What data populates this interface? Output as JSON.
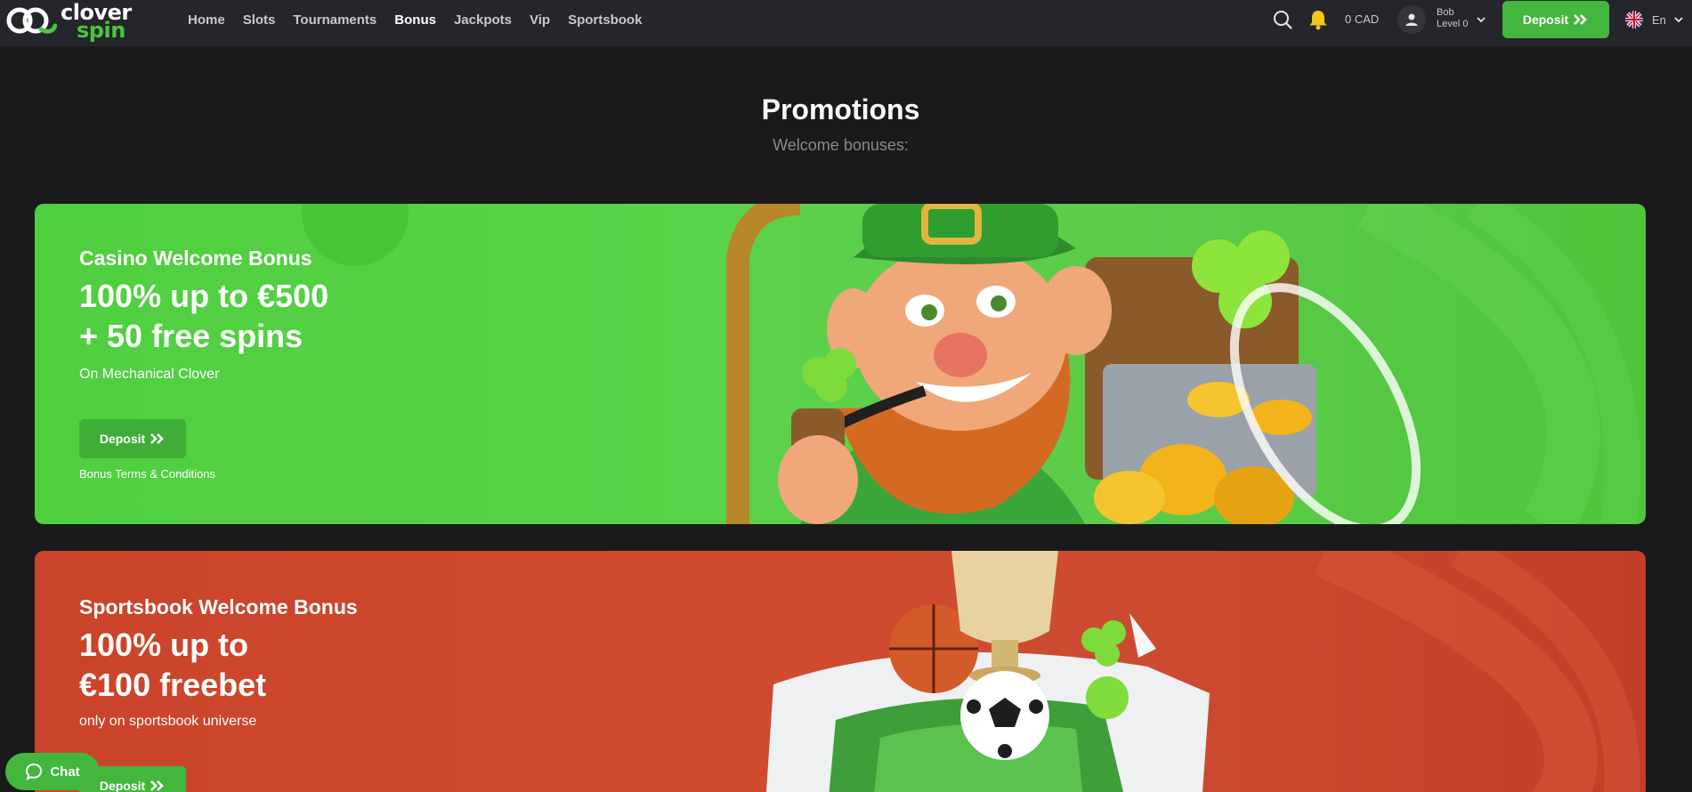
{
  "brand": {
    "line1": "clover",
    "line2": "spin",
    "accent": "#4cc43e"
  },
  "nav": {
    "items": [
      {
        "label": "Home"
      },
      {
        "label": "Slots"
      },
      {
        "label": "Tournaments"
      },
      {
        "label": "Bonus",
        "active": true
      },
      {
        "label": "Jackpots"
      },
      {
        "label": "Vip"
      },
      {
        "label": "Sportsbook"
      }
    ]
  },
  "header": {
    "balance": "0 CAD",
    "user_name": "Bob",
    "user_level": "Level 0",
    "deposit_label": "Deposit",
    "language": "En",
    "icons": [
      "search-icon",
      "bell-icon",
      "user-icon",
      "chevron-down-icon",
      "uk-flag-icon"
    ]
  },
  "page": {
    "title": "Promotions",
    "subtitle": "Welcome bonuses:"
  },
  "promos": [
    {
      "subtitle": "Casino Welcome Bonus",
      "headline_1": "100% up to €500",
      "headline_2": "+ 50 free spins",
      "note": "On Mechanical Clover",
      "deposit_label": "Deposit",
      "terms_label": "Bonus Terms & Conditions",
      "color": "#5ccf49"
    },
    {
      "subtitle": "Sportsbook Welcome Bonus",
      "headline_1": "100% up to",
      "headline_2": "€100 freebet",
      "note": "only on sportsbook universe",
      "deposit_label": "Deposit",
      "color": "#cc472d"
    }
  ],
  "chat": {
    "label": "Chat"
  }
}
